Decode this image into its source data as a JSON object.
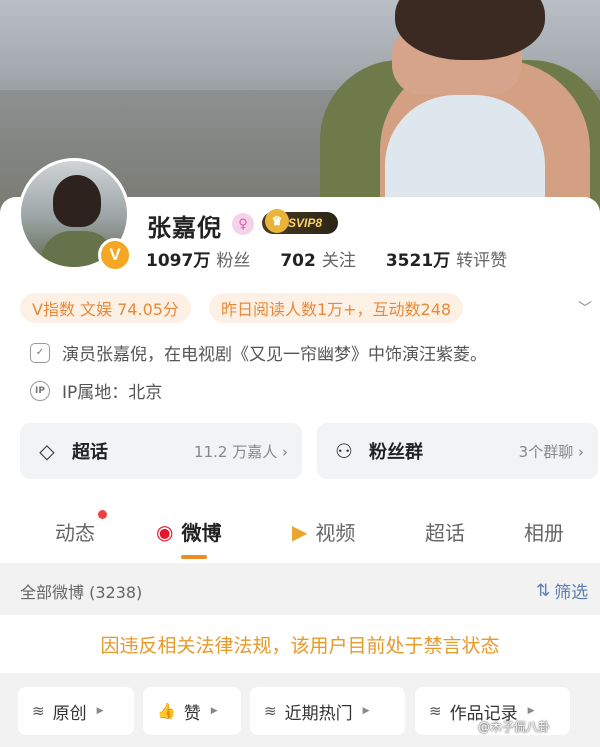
{
  "profile": {
    "name": "张嘉倪",
    "vip_label": "SVIP8",
    "verified_badge": "V",
    "stats": [
      {
        "num": "1097万",
        "label": "粉丝"
      },
      {
        "num": "702",
        "label": "关注"
      },
      {
        "num": "3521万",
        "label": "转评赞"
      }
    ],
    "tags": [
      "V指数 文娱 74.05分",
      "昨日阅读人数1万+，互动数248"
    ],
    "bio": "演员张嘉倪，在电视剧《又见一帘幽梦》中饰演汪紫菱。",
    "ip": "IP属地：北京"
  },
  "entries": [
    {
      "title": "超话",
      "sub": "11.2 万嘉人",
      "icon": "diamond-icon"
    },
    {
      "title": "粉丝群",
      "sub": "3个群聊",
      "icon": "people-icon"
    }
  ],
  "tabs": [
    {
      "label": "动态",
      "has_dot": true
    },
    {
      "label": "微博",
      "active": true
    },
    {
      "label": "视频"
    },
    {
      "label": "超话"
    },
    {
      "label": "相册"
    }
  ],
  "feed": {
    "all_label": "全部微博 (3238)",
    "filter_label": "筛选",
    "notice": "因违反相关法律法规，该用户目前处于禁言状态"
  },
  "chips": [
    {
      "label": "原创"
    },
    {
      "label": "赞"
    },
    {
      "label": "近期热门"
    },
    {
      "label": "作品记录"
    }
  ],
  "watermark": "@木子侃八卦",
  "colors": {
    "accent_orange": "#f08a24",
    "notice_text": "#e69a2a",
    "filter_blue": "#5a7fb0"
  }
}
